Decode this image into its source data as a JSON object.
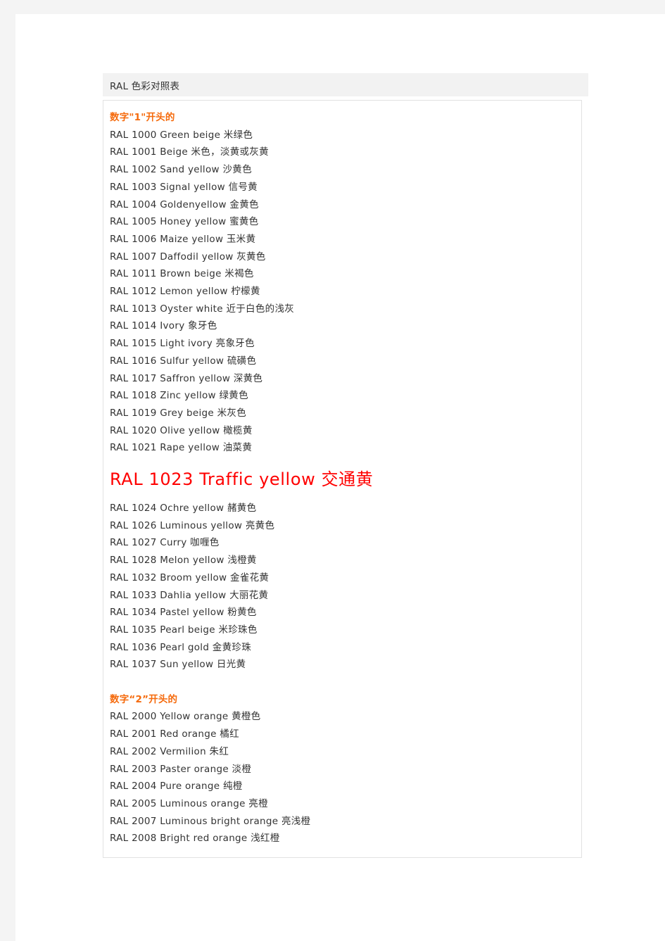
{
  "document": {
    "header_title": "RAL 色彩对照表",
    "colors": {
      "section_heading": "#f56a0c",
      "highlight_entry": "#ff0000",
      "body_text": "#333333",
      "header_bar_bg": "#f2f2f2",
      "page_gutter_bg": "#f4f4f4",
      "body_border": "#e2e2e2"
    },
    "sections": [
      {
        "heading": "数字\"1\"开头的",
        "entries": [
          {
            "text": "RAL 1000 Green beige 米绿色",
            "highlight": false
          },
          {
            "text": "RAL 1001 Beige 米色，淡黄或灰黄",
            "highlight": false
          },
          {
            "text": "RAL 1002 Sand yellow 沙黄色",
            "highlight": false
          },
          {
            "text": "RAL 1003 Signal yellow 信号黄",
            "highlight": false
          },
          {
            "text": "RAL 1004 Goldenyellow 金黄色",
            "highlight": false
          },
          {
            "text": "RAL 1005 Honey yellow 蜜黄色",
            "highlight": false
          },
          {
            "text": "RAL 1006 Maize yellow 玉米黄",
            "highlight": false
          },
          {
            "text": "RAL 1007 Daffodil yellow 灰黄色",
            "highlight": false
          },
          {
            "text": "RAL 1011 Brown beige 米褐色",
            "highlight": false
          },
          {
            "text": "RAL 1012 Lemon yellow 柠檬黄",
            "highlight": false
          },
          {
            "text": "RAL 1013 Oyster white 近于白色的浅灰",
            "highlight": false
          },
          {
            "text": "RAL 1014 Ivory 象牙色",
            "highlight": false
          },
          {
            "text": "RAL 1015 Light ivory 亮象牙色",
            "highlight": false
          },
          {
            "text": "RAL 1016 Sulfur yellow 硫磺色",
            "highlight": false
          },
          {
            "text": "RAL 1017 Saffron yellow 深黄色",
            "highlight": false
          },
          {
            "text": "RAL 1018 Zinc yellow 绿黄色",
            "highlight": false
          },
          {
            "text": "RAL 1019 Grey beige 米灰色",
            "highlight": false
          },
          {
            "text": "RAL 1020 Olive yellow 橄榄黄",
            "highlight": false
          },
          {
            "text": "RAL 1021 Rape yellow 油菜黄",
            "highlight": false
          },
          {
            "text": "RAL 1023 Traffic yellow 交通黄",
            "highlight": true
          },
          {
            "text": "RAL 1024 Ochre yellow 赭黄色",
            "highlight": false
          },
          {
            "text": "RAL 1026 Luminous yellow 亮黄色",
            "highlight": false
          },
          {
            "text": "RAL 1027 Curry 咖喱色",
            "highlight": false
          },
          {
            "text": "RAL 1028 Melon yellow 浅橙黄",
            "highlight": false
          },
          {
            "text": "RAL 1032 Broom yellow 金雀花黄",
            "highlight": false
          },
          {
            "text": "RAL 1033 Dahlia yellow 大丽花黄",
            "highlight": false
          },
          {
            "text": "RAL 1034 Pastel yellow 粉黄色",
            "highlight": false
          },
          {
            "text": "RAL 1035 Pearl beige 米珍珠色",
            "highlight": false
          },
          {
            "text": "RAL 1036 Pearl gold 金黄珍珠",
            "highlight": false
          },
          {
            "text": "RAL 1037 Sun yellow 日光黄",
            "highlight": false
          }
        ]
      },
      {
        "heading": "数字“2”开头的",
        "spacer_before": true,
        "entries": [
          {
            "text": "RAL 2000 Yellow orange 黄橙色",
            "highlight": false
          },
          {
            "text": "RAL 2001 Red orange 橘红",
            "highlight": false
          },
          {
            "text": "RAL 2002 Vermilion 朱红",
            "highlight": false
          },
          {
            "text": "RAL 2003 Paster orange 淡橙",
            "highlight": false
          },
          {
            "text": "RAL 2004 Pure orange 纯橙",
            "highlight": false
          },
          {
            "text": "RAL 2005 Luminous orange 亮橙",
            "highlight": false
          },
          {
            "text": "RAL 2007 Luminous bright orange 亮浅橙",
            "highlight": false
          },
          {
            "text": "RAL 2008 Bright red orange 浅红橙",
            "highlight": false
          }
        ]
      }
    ]
  }
}
